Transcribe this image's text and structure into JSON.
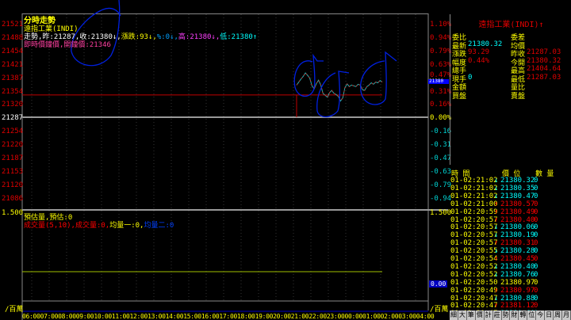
{
  "header": {
    "title": "分時走勢",
    "symbol": "遠指工業(INDI)",
    "line1": [
      {
        "t": "走勢,",
        "c": "#ffffff"
      },
      {
        "t": "昨:21287,",
        "c": "#ffffff"
      },
      {
        "t": "收:21380↓,",
        "c": "#ffffff"
      },
      {
        "t": "漲跌:93↓,",
        "c": "#ffff00"
      },
      {
        "t": "%:0↓,",
        "c": "#00a0ff"
      },
      {
        "t": "高:21380↓,",
        "c": "#ff40ff"
      },
      {
        "t": "低:21380↑",
        "c": "#00ffff"
      }
    ],
    "line2": "即時價鐘價,開鐘價:21346"
  },
  "price_axis": [
    "21521",
    "21488",
    "21454",
    "21421",
    "21387",
    "21354",
    "21320",
    "21287",
    "21254",
    "21220",
    "21187",
    "21153",
    "21120",
    "21086"
  ],
  "pct_axis": [
    "1.10%",
    "0.94%",
    "0.79%",
    "0.63%",
    "0.47%",
    "0.31%",
    "0.16%",
    "0.00%",
    "-0.16",
    "-0.31",
    "-0.47",
    "-0.63",
    "-0.79",
    "-0.94"
  ],
  "current_price_label": "21380",
  "volume": {
    "axis_top": "1.500",
    "axis_right_top": "1.500",
    "right_value": "0.00",
    "unit": "/百萬",
    "line1": "預估量,預估:0",
    "line2": [
      {
        "t": "成交量(5,10),",
        "c": "#ff0000"
      },
      {
        "t": "成交量:0,",
        "c": "#ff0000"
      },
      {
        "t": "均量一:0,",
        "c": "#ffff00"
      },
      {
        "t": "均量二:0",
        "c": "#0040ff"
      }
    ]
  },
  "time_axis": "06:0007:0008:0009:0010:0011:0012:0013:0014:0015:0016:0017:0018:0019:0020:0021:0022:0023:0000:0001:0002:0003:0004:00",
  "chart_data": {
    "type": "line",
    "prev_close": 21287,
    "open": 21346,
    "ylim": [
      21086,
      21521
    ],
    "series": [
      21372,
      21380,
      21388,
      21395,
      21404,
      21398,
      21390,
      21370,
      21362,
      21376,
      21385,
      21372,
      21350,
      21345,
      21340,
      21352,
      21358,
      21350,
      21347,
      21342,
      21330,
      21338,
      21365,
      21375,
      21368,
      21372,
      21370,
      21368,
      21374,
      21372,
      21360,
      21358,
      21368,
      21372,
      21378,
      21374,
      21380,
      21378,
      21384,
      21380
    ]
  },
  "quote": {
    "title": "遠指工業(INDI)↑",
    "rows": [
      {
        "l1": "委比",
        "v1": "",
        "c1": "#00ffff",
        "l2": "委差",
        "v2": "",
        "c2": "#e00000"
      },
      {
        "l1": "最新",
        "v1": "21380.32",
        "c1": "#00ffff",
        "l2": "均價",
        "v2": "",
        "c2": "#e00000"
      },
      {
        "l1": "漲跌",
        "v1": "93.29",
        "c1": "#e00000",
        "l2": "昨收",
        "v2": "21287.03",
        "c2": "#e00000"
      },
      {
        "l1": "幅度",
        "v1": "0.44%",
        "c1": "#e00000",
        "l2": "今開",
        "v2": "21380.32",
        "c2": "#e00000"
      },
      {
        "l1": "總手",
        "v1": "",
        "c1": "#00ffff",
        "l2": "最高",
        "v2": "21404.64",
        "c2": "#e00000"
      },
      {
        "l1": "現手",
        "v1": "0",
        "c1": "#00ffff",
        "l2": "最低",
        "v2": "21287.03",
        "c2": "#e00000"
      },
      {
        "l1": "金額",
        "v1": "",
        "c1": "#00ffff",
        "l2": "量比",
        "v2": "",
        "c2": "#e00000"
      },
      {
        "l1": "買盤",
        "v1": "",
        "c1": "#00ffff",
        "l2": "賣盤",
        "v2": "",
        "c2": "#e00000"
      }
    ]
  },
  "ticks": {
    "headers": [
      "時 間",
      "價 位",
      "數 量"
    ],
    "rows": [
      {
        "time": "01-02:21:02",
        "arrow": "↓",
        "price": "21380.32",
        "qty": "0",
        "color": "#00ffff"
      },
      {
        "time": "01-02:21:02",
        "arrow": "↓",
        "price": "21380.35",
        "qty": "0",
        "color": "#00ffff"
      },
      {
        "time": "01-02:21:02",
        "arrow": "↓",
        "price": "21380.47",
        "qty": "0",
        "color": "#00ffff"
      },
      {
        "time": "01-02:21:00",
        "arrow": "↑",
        "price": "21380.57",
        "qty": "0",
        "color": "#ff0000"
      },
      {
        "time": "01-02:20:59",
        "arrow": "↑",
        "price": "21380.49",
        "qty": "0",
        "color": "#ff0000"
      },
      {
        "time": "01-02:20:57",
        "arrow": "↑",
        "price": "21380.40",
        "qty": "0",
        "color": "#ff0000"
      },
      {
        "time": "01-02:20:57",
        "arrow": "↓",
        "price": "21380.06",
        "qty": "0",
        "color": "#00ffff"
      },
      {
        "time": "01-02:20:57",
        "arrow": "↓",
        "price": "21380.19",
        "qty": "0",
        "color": "#00ffff"
      },
      {
        "time": "01-02:20:57",
        "arrow": "↑",
        "price": "21380.31",
        "qty": "0",
        "color": "#ff0000"
      },
      {
        "time": "01-02:20:55",
        "arrow": "↓",
        "price": "21380.28",
        "qty": "0",
        "color": "#00ffff"
      },
      {
        "time": "01-02:20:54",
        "arrow": "↑",
        "price": "21380.45",
        "qty": "0",
        "color": "#ff0000"
      },
      {
        "time": "01-02:20:52",
        "arrow": "↓",
        "price": "21380.40",
        "qty": "0",
        "color": "#00ffff"
      },
      {
        "time": "01-02:20:52",
        "arrow": "↓",
        "price": "21380.76",
        "qty": "0",
        "color": "#00ffff"
      },
      {
        "time": "01-02:20:50",
        "arrow": "",
        "price": "21380.97",
        "qty": "0",
        "color": "#ffff00"
      },
      {
        "time": "01-02:20:49",
        "arrow": "↑",
        "price": "21380.97",
        "qty": "0",
        "color": "#ff0000"
      },
      {
        "time": "01-02:20:47",
        "arrow": "↓",
        "price": "21380.88",
        "qty": "0",
        "color": "#00ffff"
      },
      {
        "time": "01-02:20:47",
        "arrow": "↑",
        "price": "21381.12",
        "qty": "0",
        "color": "#ff0000"
      },
      {
        "time": "01-02:20:47",
        "arrow": "↓",
        "price": "21380.60",
        "qty": "0",
        "color": "#00ffff"
      }
    ]
  },
  "tabs": [
    "細",
    "大",
    "筆",
    "價",
    "計",
    "莊",
    "勢",
    "財",
    "轉",
    "位",
    "今",
    "日",
    "周",
    "月"
  ]
}
